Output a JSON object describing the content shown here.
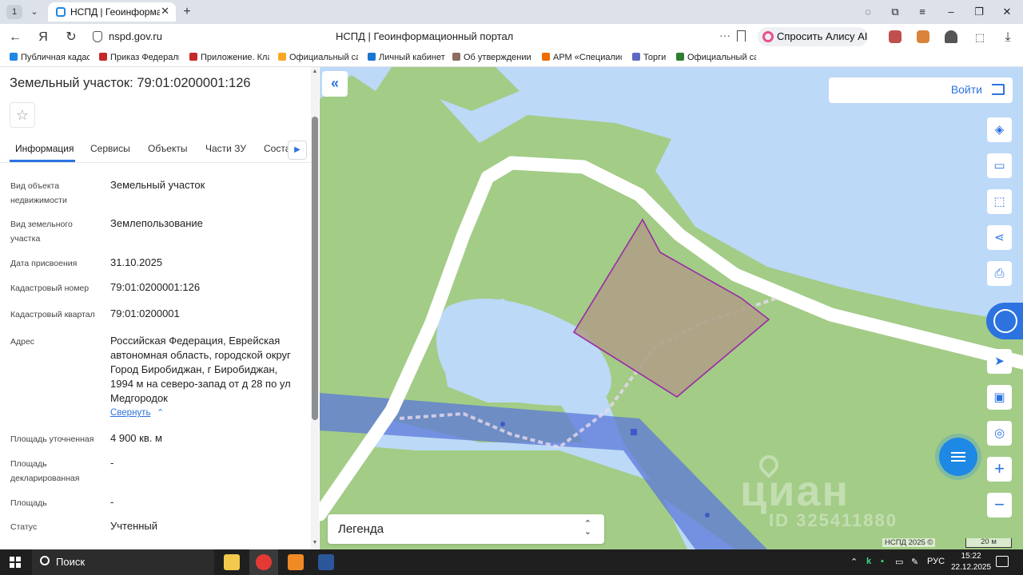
{
  "browser": {
    "tab_count": "1",
    "tab_title": "НСПД | Геоинформацио",
    "url": "nspd.gov.ru",
    "page_title": "НСПД | Геоинформационный портал",
    "alisa_label": "Спросить Алису AI",
    "bookmarks": [
      {
        "label": "Публичная кадас",
        "color": "#1e88e5"
      },
      {
        "label": "Приказ Федераль",
        "color": "#c62828"
      },
      {
        "label": "Приложение. Кла",
        "color": "#c62828"
      },
      {
        "label": "Официальный са",
        "color": "#f9a825"
      },
      {
        "label": "Личный кабинет",
        "color": "#1976d2"
      },
      {
        "label": "Об утверждении",
        "color": "#8d6e63"
      },
      {
        "label": "АРМ «Специалис",
        "color": "#ef6c00"
      },
      {
        "label": "Торги",
        "color": "#5c6bc0"
      },
      {
        "label": "Официальный са",
        "color": "#2e7d32"
      }
    ]
  },
  "panel": {
    "title": "Земельный участок: 79:01:0200001:126",
    "tabs": [
      "Информация",
      "Сервисы",
      "Объекты",
      "Части ЗУ",
      "Соста"
    ],
    "rows": [
      {
        "label": "Вид объекта недвижимости",
        "value": "Земельный участок"
      },
      {
        "label": "Вид земельного участка",
        "value": "Землепользование"
      },
      {
        "label": "Дата присвоения",
        "value": "31.10.2025"
      },
      {
        "label": "Кадастровый номер",
        "value": "79:01:0200001:126"
      },
      {
        "label": "Кадастровый квартал",
        "value": "79:01:0200001"
      },
      {
        "label": "Адрес",
        "value": "Российская Федерация, Еврейская автономная область, городской округ Город Биробиджан, г Биробиджан, 1994 м на северо-запад от д 28 по ул Медгородок"
      },
      {
        "label": "Площадь уточненная",
        "value": "4 900 кв. м"
      },
      {
        "label": "Площадь декларированная",
        "value": "-"
      },
      {
        "label": "Площадь",
        "value": "-"
      },
      {
        "label": "Статус",
        "value": "Учтенный"
      }
    ],
    "collapse_link": "Свернуть"
  },
  "map": {
    "login_label": "Войти",
    "legend_label": "Легенда",
    "watermark": "циан",
    "watermark_id": "ID 325411880",
    "copyright": "НСПД 2025 ©",
    "scale": "20 м",
    "tools": [
      "layers-icon",
      "ruler-icon",
      "select-area-icon",
      "share-icon",
      "print-icon",
      "locate-icon",
      "minimap-icon",
      "geo-search-icon"
    ]
  },
  "taskbar": {
    "search_label": "Поиск",
    "lang": "РУС",
    "time": "15:22",
    "date": "22.12.2025"
  },
  "colors": {
    "accent": "#2d73e0",
    "water": "#bcd9f8",
    "land": "#a3cc87",
    "parcel_border": "#9a2aa6",
    "parcel_fill": "#b09c86",
    "zone_fill": "#5b78d8"
  }
}
